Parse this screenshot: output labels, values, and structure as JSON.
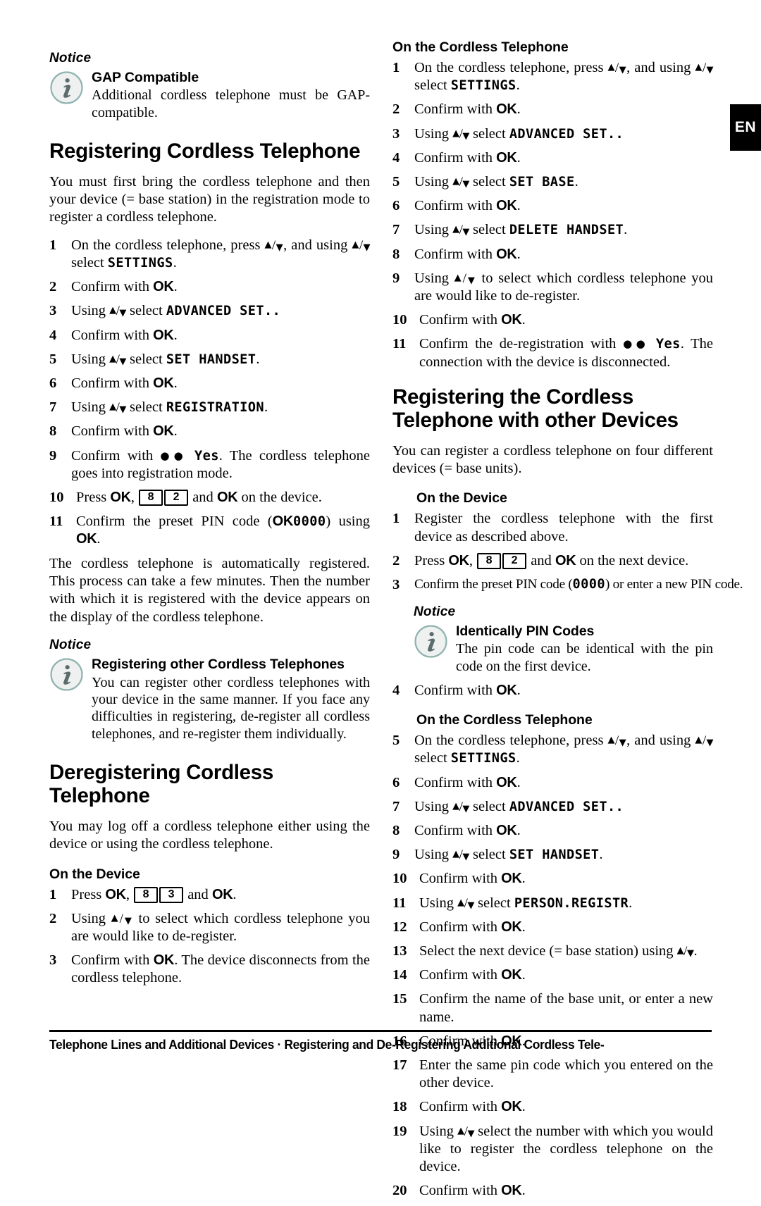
{
  "page": {
    "language_tab": "EN",
    "footer": "Telephone Lines and Additional Devices · Registering and De-Registering Additional Cordless Tele-"
  },
  "labels": {
    "notice": "Notice",
    "ok": "OK",
    "arrow_up": "▲",
    "arrow_down": "▼",
    "slash": "/",
    "dots": "●●"
  },
  "left_column": {
    "notice_gap": {
      "label": "Notice",
      "icon": "info-icon",
      "title": "GAP Compatible",
      "text": "Additional cordless telephone must be GAP-compatible."
    },
    "heading_registering": "Registering Cordless Telephone",
    "intro": "You must first bring the cordless telephone and then your device (= base station) in the registration mode to register a cordless telephone.",
    "steps_registering": [
      {
        "n": "1",
        "pre": "On the cordless telephone, press ",
        "arrows1": true,
        "mid": ", and using ",
        "arrows2": true,
        "post": " select ",
        "lcd": "SETTINGS",
        "end": "."
      },
      {
        "n": "2",
        "pre": "Confirm with ",
        "ok": true,
        "end": "."
      },
      {
        "n": "3",
        "pre": "Using ",
        "arrows1": true,
        "post": " select ",
        "lcd": "ADVANCED SET..",
        "end": ""
      },
      {
        "n": "4",
        "pre": "Confirm with ",
        "ok": true,
        "end": "."
      },
      {
        "n": "5",
        "pre": "Using ",
        "arrows1": true,
        "post": " select ",
        "lcd": "SET HANDSET",
        "end": "."
      },
      {
        "n": "6",
        "pre": "Confirm with ",
        "ok": true,
        "end": "."
      },
      {
        "n": "7",
        "pre": "Using ",
        "arrows1": true,
        "post": " select ",
        "lcd": "REGISTRATION",
        "end": "."
      },
      {
        "n": "8",
        "pre": "Confirm with ",
        "ok": true,
        "end": "."
      },
      {
        "n": "9",
        "pre": "Confirm with ",
        "dots": true,
        "lcd": "Yes",
        "end": ". The cordless telephone goes into registration mode."
      },
      {
        "n": "10",
        "pre": "Press ",
        "ok": true,
        "keys": [
          "8",
          "2"
        ],
        "mid2": " and ",
        "ok2": true,
        "end": " on the device."
      },
      {
        "n": "11",
        "pre": "Confirm the preset PIN code (",
        "lcd": "0000",
        "mid3": ") using ",
        "ok": true,
        "end": "."
      }
    ],
    "after_steps": "The cordless telephone is automatically registered. This process can take a few minutes. Then the number with which it is registered with the device appears on the display of the cordless telephone.",
    "notice_other": {
      "label": "Notice",
      "icon": "info-icon",
      "title": "Registering other Cordless Telephones",
      "text": "You can register other cordless telephones with your device in the same manner. If you face any difficulties in registering, de-register all cordless telephones, and re-register them individually."
    },
    "heading_deregistering": "Deregistering Cordless Telephone",
    "deregister_intro": "You may log off a cordless telephone either using the device or using the cordless telephone.",
    "subhead_on_device": "On the Device",
    "steps_device": [
      {
        "n": "1",
        "pre": "Press ",
        "ok": true,
        "keys": [
          "8",
          "3"
        ],
        "mid2": " and ",
        "ok2": true,
        "end": "."
      },
      {
        "n": "2",
        "pre": "Using ",
        "arrows1": true,
        "post": " to select which cordless telephone you are would like to de-register.",
        "end": ""
      },
      {
        "n": "3",
        "pre": "Confirm with ",
        "ok": true,
        "end": ". The device disconnects from the cordless telephone."
      }
    ]
  },
  "right_column": {
    "subhead_on_cordless": "On the Cordless Telephone",
    "steps_cordless": [
      {
        "n": "1",
        "pre": "On the cordless telephone, press ",
        "arrows1": true,
        "mid": ", and using ",
        "arrows2": true,
        "post": " select ",
        "lcd": "SETTINGS",
        "end": "."
      },
      {
        "n": "2",
        "pre": "Confirm with ",
        "ok": true,
        "end": "."
      },
      {
        "n": "3",
        "pre": "Using ",
        "arrows1": true,
        "post": " select ",
        "lcd": "ADVANCED SET..",
        "end": ""
      },
      {
        "n": "4",
        "pre": "Confirm with ",
        "ok": true,
        "end": "."
      },
      {
        "n": "5",
        "pre": "Using ",
        "arrows1": true,
        "post": " select ",
        "lcd": "SET BASE",
        "end": "."
      },
      {
        "n": "6",
        "pre": "Confirm with ",
        "ok": true,
        "end": "."
      },
      {
        "n": "7",
        "pre": "Using ",
        "arrows1": true,
        "post": " select ",
        "lcd": "DELETE HANDSET",
        "end": "."
      },
      {
        "n": "8",
        "pre": "Confirm with ",
        "ok": true,
        "end": "."
      },
      {
        "n": "9",
        "pre": "Using ",
        "arrows1": true,
        "post": " to select which cordless telephone you are would like to de-register.",
        "end": ""
      },
      {
        "n": "10",
        "pre": "Confirm with ",
        "ok": true,
        "end": "."
      },
      {
        "n": "11",
        "pre": "Confirm the de-registration with ",
        "dots": true,
        "lcd": "Yes",
        "end": ". The connection with the device is disconnected."
      }
    ],
    "heading_other_devices": "Registering the Cordless Telephone with other Devices",
    "other_devices_intro": "You can register a cordless telephone on four different devices (= base units).",
    "subhead_on_device": "On the Device",
    "steps_other_device": [
      {
        "n": "1",
        "pre": "Register the cordless telephone with the first device as described above.",
        "end": ""
      },
      {
        "n": "2",
        "pre": "Press ",
        "ok": true,
        "keys": [
          "8",
          "2"
        ],
        "mid2": " and ",
        "ok2": true,
        "end": " on the next device."
      },
      {
        "n": "3",
        "pre": "Confirm the preset PIN code (",
        "lcd": "0000",
        "mid3": ") or enter a new PIN code.",
        "end": ""
      }
    ],
    "notice_pin": {
      "label": "Notice",
      "icon": "info-icon",
      "title": "Identically PIN Codes",
      "text": "The pin code can be identical with the pin code on the first device."
    },
    "step_4": {
      "n": "4",
      "pre": "Confirm with ",
      "ok": true,
      "end": "."
    },
    "subhead_on_cordless_2": "On the Cordless Telephone",
    "steps_final": [
      {
        "n": "5",
        "pre": "On the cordless telephone, press ",
        "arrows1": true,
        "mid": ", and using ",
        "arrows2": true,
        "post": " select ",
        "lcd": "SETTINGS",
        "end": "."
      },
      {
        "n": "6",
        "pre": "Confirm with ",
        "ok": true,
        "end": "."
      },
      {
        "n": "7",
        "pre": "Using ",
        "arrows1": true,
        "post": " select ",
        "lcd": "ADVANCED SET..",
        "end": ""
      },
      {
        "n": "8",
        "pre": "Confirm with ",
        "ok": true,
        "end": "."
      },
      {
        "n": "9",
        "pre": "Using ",
        "arrows1": true,
        "post": " select ",
        "lcd": "SET HANDSET",
        "end": "."
      },
      {
        "n": "10",
        "pre": "Confirm with ",
        "ok": true,
        "end": "."
      },
      {
        "n": "11",
        "pre": "Using ",
        "arrows1": true,
        "post": " select ",
        "lcd": "PERSON.REGISTR",
        "end": "."
      },
      {
        "n": "12",
        "pre": "Confirm with ",
        "ok": true,
        "end": "."
      },
      {
        "n": "13",
        "pre": "Select the next device (= base station) using ",
        "arrows1": true,
        "post": ".",
        "end": ""
      },
      {
        "n": "14",
        "pre": "Confirm with ",
        "ok": true,
        "end": "."
      },
      {
        "n": "15",
        "pre": "Confirm the name of the base unit, or enter a new name.",
        "end": ""
      },
      {
        "n": "16",
        "pre": "Confirm with ",
        "ok": true,
        "end": "."
      },
      {
        "n": "17",
        "pre": "Enter the same pin code which you entered on the other device.",
        "end": ""
      },
      {
        "n": "18",
        "pre": "Confirm with ",
        "ok": true,
        "end": "."
      },
      {
        "n": "19",
        "pre": "Using ",
        "arrows1": true,
        "post": " select the number with which you would like to register the cordless telephone on the device.",
        "end": ""
      },
      {
        "n": "20",
        "pre": "Confirm with ",
        "ok": true,
        "end": "."
      }
    ]
  },
  "colors": {
    "text": "#000000",
    "page_bg": "#ffffff",
    "tab_bg": "#000000",
    "tab_text": "#ffffff",
    "icon_ring": "#8fb3b0",
    "icon_fill": "#eef1f0",
    "icon_glyph": "#5c6b6b"
  }
}
